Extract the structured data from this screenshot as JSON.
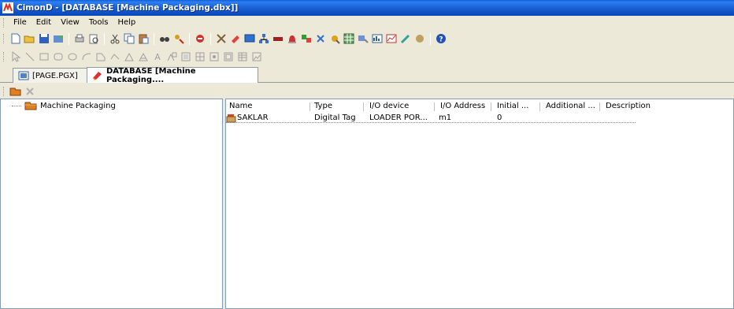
{
  "window": {
    "title": "CimonD - [DATABASE [Machine Packaging.dbx]]"
  },
  "menu": [
    {
      "label": "File",
      "key": "F"
    },
    {
      "label": "Edit",
      "key": "E"
    },
    {
      "label": "View",
      "key": "V"
    },
    {
      "label": "Tools",
      "key": "T"
    },
    {
      "label": "Help",
      "key": "H"
    }
  ],
  "tabs": [
    {
      "label": "[PAGE.PGX]"
    },
    {
      "label": "DATABASE [Machine Packaging...."
    }
  ],
  "tree": {
    "root_label": "Machine Packaging"
  },
  "table": {
    "columns": [
      "Name",
      "Type",
      "I/O device",
      "I/O Address",
      "Initial ...",
      "Additional ...",
      "Description"
    ],
    "rows": [
      {
        "name": "SAKLAR",
        "type": "Digital Tag",
        "io_device": "LOADER POR...",
        "io_address": "m1",
        "initial": "0",
        "additional": "",
        "description": ""
      }
    ]
  },
  "colors": {
    "titlebar": "#0a5fd8",
    "chrome": "#ece9d8",
    "border": "#7f9db9"
  },
  "icons": {
    "toolbar1": [
      "new-icon",
      "open-icon",
      "save-icon",
      "project-icon",
      "print-icon",
      "print-preview-icon",
      "cut-icon",
      "copy-icon",
      "paste-icon",
      "find-icon",
      "replace-icon",
      "delete-icon",
      "tool-icon",
      "database-icon",
      "screen-icon",
      "network-icon",
      "io-icon",
      "alarm-icon",
      "user-icon",
      "script-icon",
      "settings-icon",
      "grid-icon",
      "chart-icon",
      "report-icon",
      "trend-icon",
      "recipe-icon",
      "help-icon"
    ],
    "toolbar2": [
      "pointer-icon",
      "line-icon",
      "rectangle-icon",
      "rounded-rect-icon",
      "ellipse-icon",
      "arc-icon",
      "polygon-icon",
      "polyline-icon",
      "pie-icon",
      "chord-icon",
      "text-icon",
      "image-icon",
      "group-icon",
      "ungroup-icon",
      "table-icon",
      "frame-icon",
      "picture-icon"
    ]
  }
}
